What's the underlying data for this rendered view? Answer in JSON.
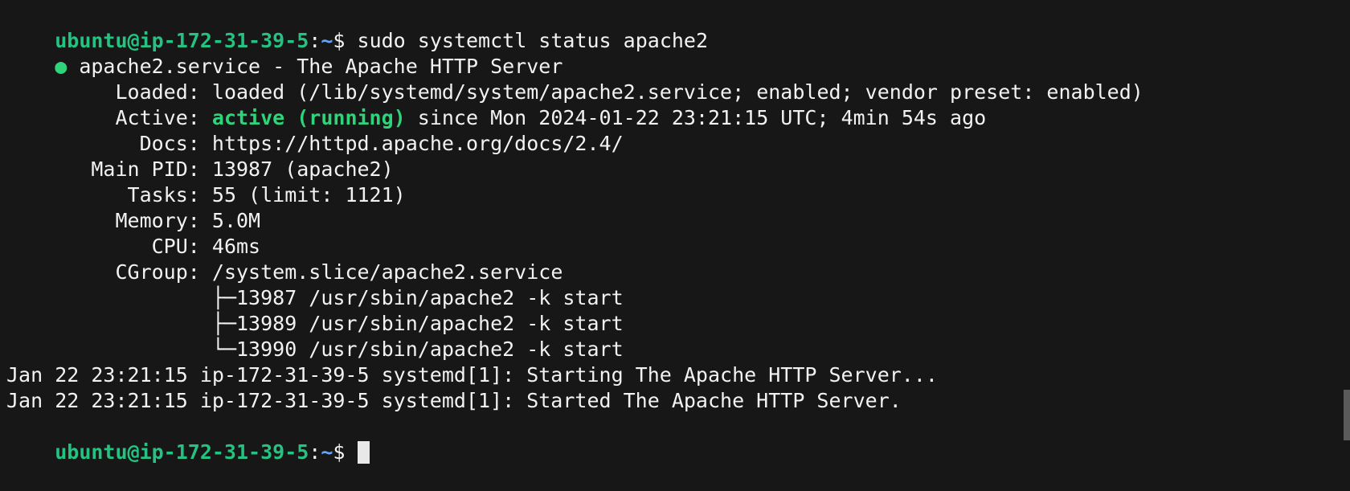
{
  "prompt": {
    "user_host": "ubuntu@ip-172-31-39-5",
    "separator": ":",
    "path": "~",
    "symbol": "$ "
  },
  "command": "sudo systemctl status apache2",
  "status": {
    "dot": "●",
    "header": " apache2.service - The Apache HTTP Server",
    "loaded_label": "     Loaded: ",
    "loaded_value": "loaded (/lib/systemd/system/apache2.service; enabled; vendor preset: enabled)",
    "active_label": "     Active: ",
    "active_state": "active (running)",
    "active_since": " since Mon 2024-01-22 23:21:15 UTC; 4min 54s ago",
    "docs_label": "       Docs: ",
    "docs_value": "https://httpd.apache.org/docs/2.4/",
    "pid_label": "   Main PID: ",
    "pid_value": "13987 (apache2)",
    "tasks_label": "      Tasks: ",
    "tasks_value": "55 (limit: 1121)",
    "memory_label": "     Memory: ",
    "memory_value": "5.0M",
    "cpu_label": "        CPU: ",
    "cpu_value": "46ms",
    "cgroup_label": "     CGroup: ",
    "cgroup_value": "/system.slice/apache2.service",
    "processes": [
      {
        "tree": "             ├─",
        "text": "13987 /usr/sbin/apache2 -k start"
      },
      {
        "tree": "             ├─",
        "text": "13989 /usr/sbin/apache2 -k start"
      },
      {
        "tree": "             └─",
        "text": "13990 /usr/sbin/apache2 -k start"
      }
    ]
  },
  "logs": [
    "Jan 22 23:21:15 ip-172-31-39-5 systemd[1]: Starting The Apache HTTP Server...",
    "Jan 22 23:21:15 ip-172-31-39-5 systemd[1]: Started The Apache HTTP Server."
  ],
  "colors": {
    "background": "#171717",
    "foreground": "#f2f2f2",
    "prompt_user": "#26c281",
    "prompt_path": "#5fa8ff",
    "active": "#2ed47a"
  }
}
